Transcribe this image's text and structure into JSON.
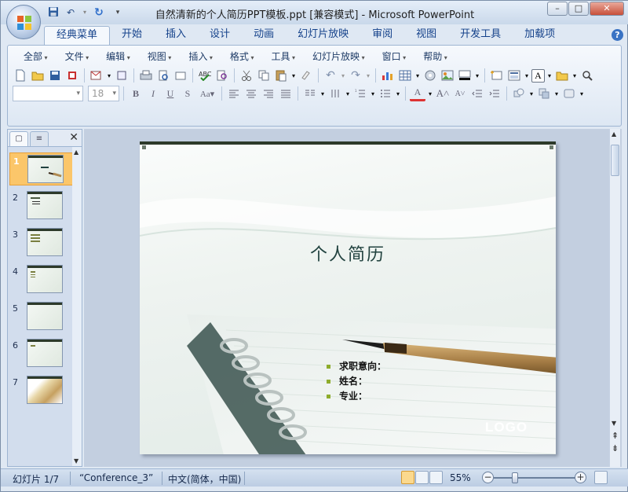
{
  "window": {
    "title": "自然清新的个人简历PPT模板.ppt [兼容模式] - Microsoft PowerPoint",
    "minimize": "–",
    "maximize": "□",
    "close": "✕"
  },
  "quick_access": {
    "save_icon": "floppy-disk-icon",
    "undo": "↶",
    "redo": "↻",
    "customize": "▾"
  },
  "tabs": [
    "经典菜单",
    "开始",
    "插入",
    "设计",
    "动画",
    "幻灯片放映",
    "审阅",
    "视图",
    "开发工具",
    "加载项"
  ],
  "help": "?",
  "menubar": [
    "全部",
    "文件",
    "编辑",
    "视图",
    "插入",
    "格式",
    "工具",
    "幻灯片放映",
    "窗口",
    "帮助"
  ],
  "font_box": {
    "name": "",
    "size": "18"
  },
  "slides_panel": {
    "close": "✕",
    "slides": [
      {
        "num": "1"
      },
      {
        "num": "2"
      },
      {
        "num": "3"
      },
      {
        "num": "4"
      },
      {
        "num": "5"
      },
      {
        "num": "6"
      },
      {
        "num": "7"
      }
    ]
  },
  "slide": {
    "title": "个人简历",
    "bullets": [
      "求职意向：",
      "姓名：",
      "专业："
    ],
    "logo": "LOGO"
  },
  "statusbar": {
    "slide_count": "幻灯片 1/7",
    "theme": "“Conference_3”",
    "language": "中文(简体，中国)",
    "zoom": "55%",
    "zoom_out": "−",
    "zoom_in": "+"
  },
  "colors": {
    "ribbon_blue": "#dfe8f3",
    "tab_text": "#15428b",
    "selected_slide": "#fbc66a",
    "bullet_green": "#8eac2c",
    "slide_bar": "#2d3a2a"
  }
}
